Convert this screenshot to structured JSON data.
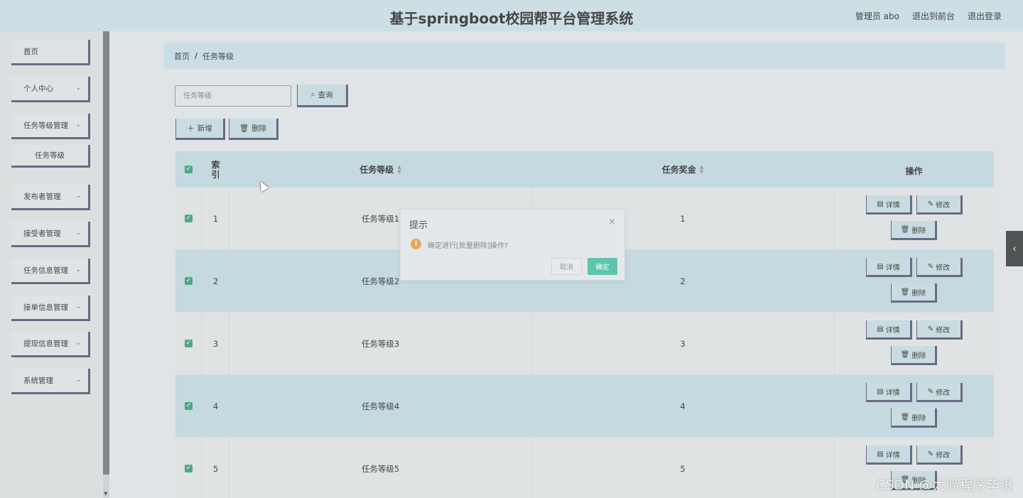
{
  "header": {
    "title": "基于springboot校园帮平台管理系统",
    "user": "管理员 abo",
    "to_front": "退出到前台",
    "logout": "退出登录"
  },
  "sidebar": {
    "items": [
      {
        "label": "首页",
        "expandable": false
      },
      {
        "label": "个人中心",
        "expandable": true
      },
      {
        "label": "任务等级管理",
        "expandable": true
      },
      {
        "label": "任务等级",
        "expandable": false,
        "sub": true
      },
      {
        "label": "发布者管理",
        "expandable": true
      },
      {
        "label": "接受者管理",
        "expandable": true
      },
      {
        "label": "任务信息管理",
        "expandable": true
      },
      {
        "label": "接单信息管理",
        "expandable": true
      },
      {
        "label": "提现信息管理",
        "expandable": true
      },
      {
        "label": "系统管理",
        "expandable": true
      }
    ]
  },
  "breadcrumb": {
    "home": "首页",
    "separator": "/",
    "current": "任务等级"
  },
  "search": {
    "placeholder": "任务等级",
    "button": "查询"
  },
  "toolbar": {
    "add": "新增",
    "delete": "删除"
  },
  "table": {
    "columns": {
      "index": "索引",
      "level": "任务等级",
      "bonus": "任务奖金",
      "ops": "操作"
    },
    "rows": [
      {
        "index": "1",
        "level": "任务等级1",
        "bonus": "1",
        "checked": true
      },
      {
        "index": "2",
        "level": "任务等级2",
        "bonus": "2",
        "checked": true
      },
      {
        "index": "3",
        "level": "任务等级3",
        "bonus": "3",
        "checked": true
      },
      {
        "index": "4",
        "level": "任务等级4",
        "bonus": "4",
        "checked": true
      },
      {
        "index": "5",
        "level": "任务等级5",
        "bonus": "5",
        "checked": true
      }
    ],
    "row_actions": {
      "detail": "详情",
      "edit": "修改",
      "delete": "删除"
    }
  },
  "dialog": {
    "title": "提示",
    "message": "确定进行[批量删除]操作?",
    "cancel": "取消",
    "confirm": "确定"
  },
  "watermark": "CSDN @大简程序毕设",
  "colors": {
    "header_bg": "#c7dbe3",
    "button_bg": "#c3d8df",
    "button_border": "#4d4f6e",
    "checkbox": "#2d9a6b",
    "confirm": "#5fc4ae",
    "warning": "#e3a85a"
  }
}
